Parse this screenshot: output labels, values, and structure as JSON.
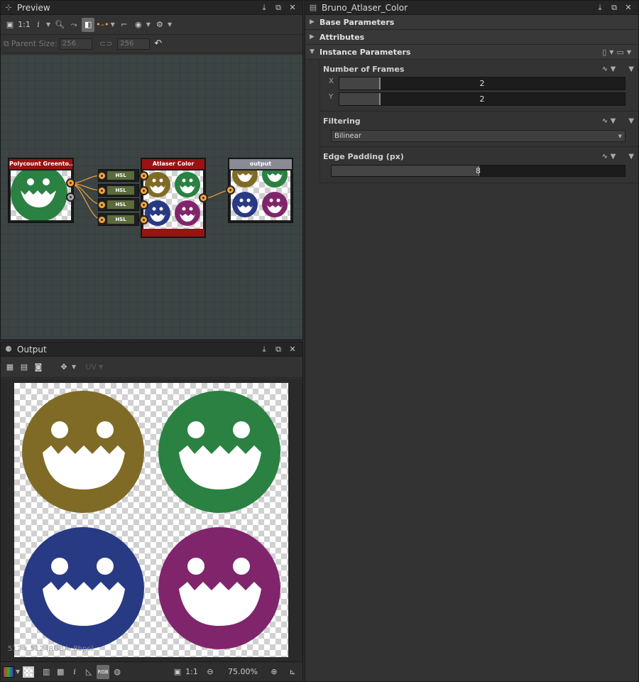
{
  "colors": {
    "olive": "#7f6b25",
    "green": "#2a8142",
    "blue": "#283a84",
    "purple": "#80256b",
    "node_red": "#9a1212",
    "output_grey": "#8a8a95",
    "accent_orange": "#f3a33a"
  },
  "preview": {
    "title": "Preview",
    "toolbar": {
      "fit_label": "1:1",
      "info_label": "i"
    },
    "parent_size_label": "Parent Size:",
    "parent_w": "256",
    "parent_h": "256"
  },
  "graph": {
    "nodes": {
      "input": {
        "title": "Polycount Greento..."
      },
      "hsl": [
        "HSL",
        "HSL",
        "HSL",
        "HSL"
      ],
      "atlaser": {
        "title": "Atlaser Color"
      },
      "output": {
        "title": "output"
      }
    }
  },
  "output": {
    "title": "Output",
    "uv_label": "UV",
    "image_info": "512 x 512 (RGBA, 8bpc)",
    "zoom": "75.00%",
    "fit_label": "1:1",
    "info_label": "i"
  },
  "params": {
    "title": "Bruno_Atlaser_Color",
    "sections": {
      "base": "Base Parameters",
      "attributes": "Attributes",
      "instance": "Instance Parameters"
    },
    "frames": {
      "label": "Number of Frames",
      "x_label": "X",
      "x_value": "2",
      "y_label": "Y",
      "y_value": "2"
    },
    "filtering": {
      "label": "Filtering",
      "value": "Bilinear"
    },
    "edge_padding": {
      "label": "Edge Padding (px)",
      "value": "8"
    }
  },
  "icons": {
    "titlebar_controls": [
      "pin-icon",
      "float-icon",
      "close-icon"
    ],
    "section_arrow_collapsed": "▶",
    "section_arrow_expanded": "▼"
  }
}
